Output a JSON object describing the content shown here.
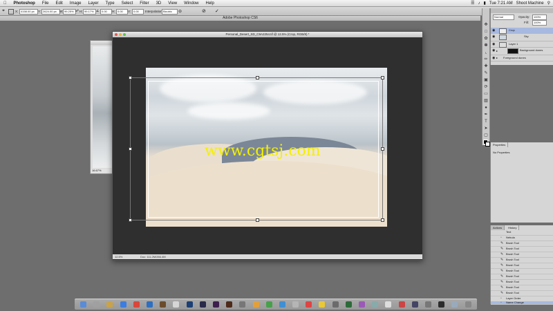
{
  "menubar": {
    "app": "Photoshop",
    "items": [
      "File",
      "Edit",
      "Image",
      "Layer",
      "Type",
      "Select",
      "Filter",
      "3D",
      "View",
      "Window",
      "Help"
    ],
    "clock": "Tue 7:21 AM",
    "user": "Shoot Machine"
  },
  "options": {
    "fields": [
      "4158.00 px",
      "2624.00 px",
      "99.25%",
      "99.17%",
      "0.00",
      "0.00",
      "0.00"
    ],
    "interp_label": "Interpolation:",
    "interp_value": "Bicubic"
  },
  "app_title": "Adobe Photoshop CS6",
  "document": {
    "title": "Personal_Desert_SD_C9A2254.tif @ 12.5% (Crop, RGB/8) *",
    "zoom": "12.5%",
    "status": "Doc: 111.2M/266.4M",
    "watermark": "www.cgtsj.com"
  },
  "back_document": {
    "zoom": "16.67%"
  },
  "layers_panel": {
    "mode": "Normal",
    "opacity_label": "Opacity:",
    "opacity": "100%",
    "fill_label": "Fill:",
    "fill": "100%",
    "rows": [
      {
        "name": "Crop"
      },
      {
        "name": "Sky"
      },
      {
        "name": "Layer 1"
      },
      {
        "name": "Background dunes"
      },
      {
        "name": "Foreground dunes"
      }
    ]
  },
  "properties_panel": {
    "tab": "Properties",
    "text": "No Properties"
  },
  "history_panel": {
    "tabs": [
      "Actions",
      "History"
    ],
    "rows": [
      "Text",
      "Nebula",
      "Brush Tool",
      "Brush Tool",
      "Brush Tool",
      "Brush Tool",
      "Brush Tool",
      "Brush Tool",
      "Brush Tool",
      "Brush Tool",
      "Brush Tool",
      "Brush Tool",
      "Layer Order",
      "Name Change"
    ]
  },
  "colors": {
    "workspace": "#6e6e6e",
    "canvas_bg": "#2f2f2f",
    "selection": "#a7b9e0",
    "watermark": "#f4f000"
  }
}
